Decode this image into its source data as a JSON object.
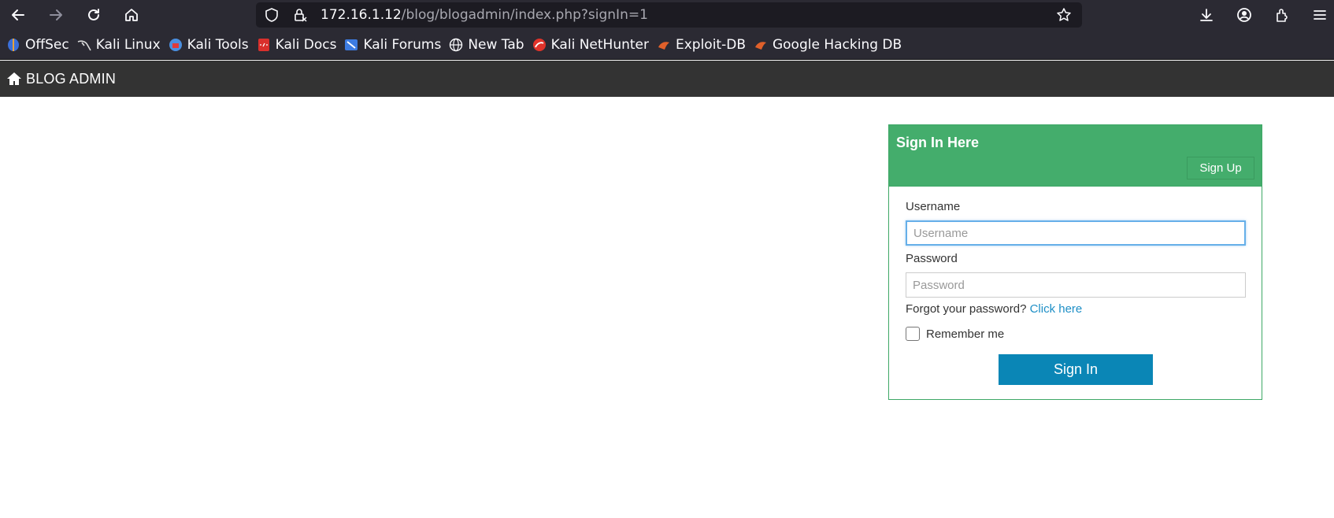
{
  "browser": {
    "url_host": "172.16.1.12",
    "url_path": "/blog/blogadmin/index.php?signIn=1",
    "icons": [
      "back-icon",
      "forward-icon",
      "reload-icon",
      "home-icon",
      "shield-icon",
      "lock-icon",
      "star-icon",
      "download-icon",
      "account-icon",
      "extensions-icon",
      "menu-icon"
    ]
  },
  "bookmarks": [
    {
      "label": "OffSec",
      "icon": "offsec-icon",
      "color": "#3b6fd9"
    },
    {
      "label": "Kali Linux",
      "icon": "kali-icon",
      "color": "#dddddd"
    },
    {
      "label": "Kali Tools",
      "icon": "kali-tools-icon",
      "color": "#4a8fe0"
    },
    {
      "label": "Kali Docs",
      "icon": "kali-docs-icon",
      "color": "#d9302c"
    },
    {
      "label": "Kali Forums",
      "icon": "kali-forums-icon",
      "color": "#3d7be0"
    },
    {
      "label": "New Tab",
      "icon": "globe-icon",
      "color": "#fbfbfe"
    },
    {
      "label": "Kali NetHunter",
      "icon": "nethunter-icon",
      "color": "#e0332a"
    },
    {
      "label": "Exploit-DB",
      "icon": "exploit-db-icon",
      "color": "#e0602a"
    },
    {
      "label": "Google Hacking DB",
      "icon": "ghdb-icon",
      "color": "#e0602a"
    }
  ],
  "navbar": {
    "brand": "BLOG ADMIN"
  },
  "signin": {
    "title": "Sign In Here",
    "signup_label": "Sign Up",
    "username_label": "Username",
    "username_placeholder": "Username",
    "username_value": "",
    "password_label": "Password",
    "password_placeholder": "Password",
    "password_value": "",
    "forgot_text": "Forgot your password?",
    "forgot_link": "Click here",
    "remember_label": "Remember me",
    "remember_checked": false,
    "submit_label": "Sign In"
  },
  "colors": {
    "panel_green": "#44ad6c",
    "button_blue": "#0a86b6",
    "link_blue": "#1e8fc6",
    "navbar": "#333333"
  }
}
